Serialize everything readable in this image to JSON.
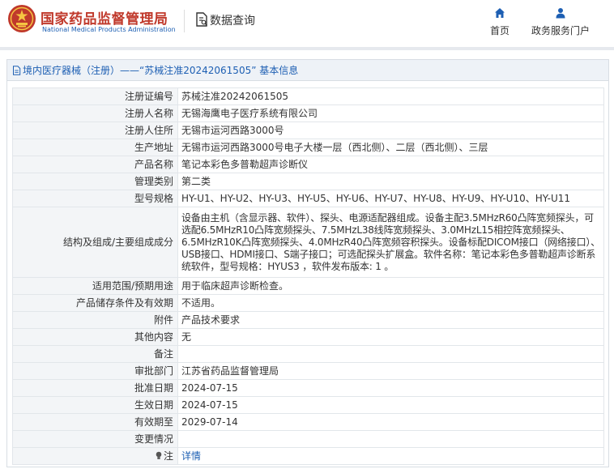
{
  "header": {
    "brand_cn": "国家药品监督管理局",
    "brand_en": "National Medical Products Administration",
    "page_title": "数据查询",
    "nav": {
      "home": "首页",
      "gov_portal": "政务服务门户"
    }
  },
  "breadcrumb": {
    "section": "境内医疗器械（注册）",
    "separator": "——",
    "record": "“苏械注准20242061505”",
    "suffix": "基本信息"
  },
  "rows": [
    {
      "label": "注册证编号",
      "value": "苏械注准20242061505"
    },
    {
      "label": "注册人名称",
      "value": "无锡海鹰电子医疗系统有限公司"
    },
    {
      "label": "注册人住所",
      "value": "无锡市运河西路3000号"
    },
    {
      "label": "生产地址",
      "value": "无锡市运河西路3000号电子大楼一层（西北侧）、二层（西北侧）、三层"
    },
    {
      "label": "产品名称",
      "value": "笔记本彩色多普勒超声诊断仪"
    },
    {
      "label": "管理类别",
      "value": "第二类"
    },
    {
      "label": "型号规格",
      "value": "HY-U1、HY-U2、HY-U3、HY-U5、HY-U6、HY-U7、HY-U8、HY-U9、HY-U10、HY-U11"
    },
    {
      "label": "结构及组成/主要组成成分",
      "value": "设备由主机（含显示器、软件）、探头、电源适配器组成。设备主配3.5MHzR60凸阵宽频探头，可选配6.5MHzR10凸阵宽频探头、7.5MHzL38线阵宽频探头、3.0MHzL15相控阵宽频探头、6.5MHzR10K凸阵宽频探头、4.0MHzR40凸阵宽频容积探头。设备标配DICOM接口（网络接口）、USB接口、HDMI接口、S端子接口；可选配探头扩展盒。软件名称：笔记本彩色多普勒超声诊断系统软件，型号规格：HYUS3 ，软件发布版本: 1 。"
    },
    {
      "label": "适用范围/预期用途",
      "value": "用于临床超声诊断检查。"
    },
    {
      "label": "产品储存条件及有效期",
      "value": "不适用。"
    },
    {
      "label": "附件",
      "value": "产品技术要求"
    },
    {
      "label": "其他内容",
      "value": "无"
    },
    {
      "label": "备注",
      "value": ""
    },
    {
      "label": "审批部门",
      "value": "江苏省药品监督管理局"
    },
    {
      "label": "批准日期",
      "value": "2024-07-15"
    },
    {
      "label": "生效日期",
      "value": "2024-07-15"
    },
    {
      "label": "有效期至",
      "value": "2029-07-14"
    },
    {
      "label": "变更情况",
      "value": ""
    },
    {
      "label": "注",
      "value": "详情"
    }
  ],
  "colors": {
    "brand_red": "#c0392b",
    "link_blue": "#1d5fb3",
    "label_bg": "#f3f5f7",
    "breadcrumb_bg": "#eef2f7"
  },
  "icons": [
    "national-emblem-icon",
    "document-search-icon",
    "home-icon",
    "user-icon",
    "file-icon",
    "lightbulb-icon"
  ]
}
